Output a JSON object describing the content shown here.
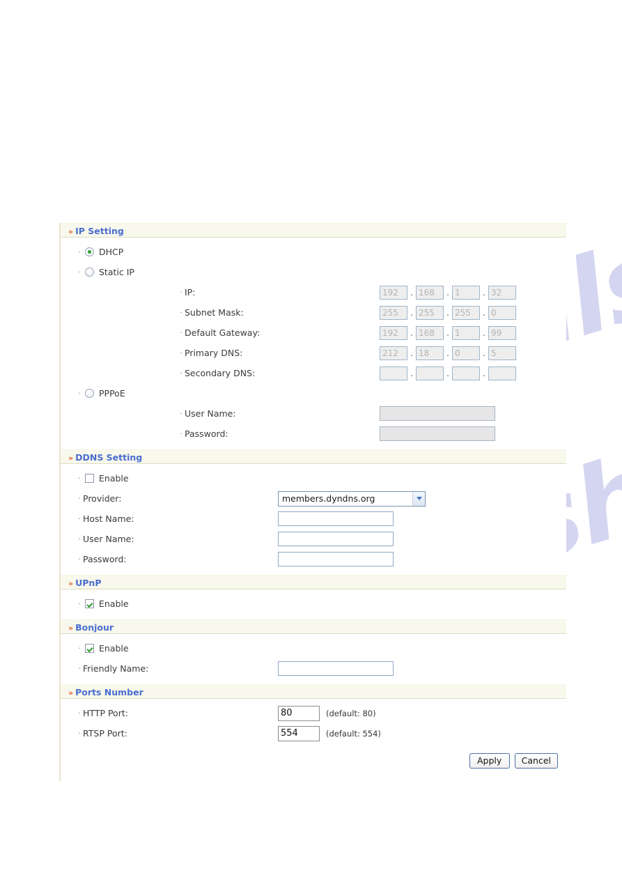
{
  "watermark": {
    "line1": "manualshive.com",
    "line2": "manualshive.com"
  },
  "sections": [
    {
      "id": "ip-setting",
      "title": "IP Setting",
      "marker": "»",
      "modes": [
        {
          "label": "DHCP",
          "selected": true
        },
        {
          "label": "Static IP",
          "selected": false
        },
        {
          "label": "PPPoE",
          "selected": false
        }
      ],
      "ip_rows": [
        {
          "label": "IP:",
          "octets": [
            "192",
            "168",
            "1",
            "32"
          ]
        },
        {
          "label": "Subnet Mask:",
          "octets": [
            "255",
            "255",
            "255",
            "0"
          ]
        },
        {
          "label": "Default Gateway:",
          "octets": [
            "192",
            "168",
            "1",
            "99"
          ]
        },
        {
          "label": "Primary DNS:",
          "octets": [
            "212",
            "18",
            "0",
            "5"
          ]
        },
        {
          "label": "Secondary DNS:",
          "octets": [
            "",
            "",
            "",
            ""
          ]
        }
      ],
      "pppoe_fields": [
        {
          "label": "User Name:",
          "value": ""
        },
        {
          "label": "Password:",
          "value": ""
        }
      ]
    },
    {
      "id": "ddns-setting",
      "title": "DDNS Setting",
      "marker": "»",
      "enable": {
        "label": "Enable",
        "checked": false
      },
      "provider": {
        "label": "Provider:",
        "selected": "members.dyndns.org",
        "options": [
          "members.dyndns.org"
        ]
      },
      "fields": [
        {
          "label": "Host Name:",
          "value": ""
        },
        {
          "label": "User Name:",
          "value": ""
        },
        {
          "label": "Password:",
          "value": ""
        }
      ]
    },
    {
      "id": "upnp",
      "title": "UPnP",
      "marker": "»",
      "enable": {
        "label": "Enable",
        "checked": true
      }
    },
    {
      "id": "bonjour",
      "title": "Bonjour",
      "marker": "»",
      "enable": {
        "label": "Enable",
        "checked": true
      },
      "friendly_name": {
        "label": "Friendly Name:",
        "value": ""
      }
    },
    {
      "id": "ports-number",
      "title": "Ports Number",
      "marker": "»",
      "ports": [
        {
          "label": "HTTP Port:",
          "value": "80",
          "hint": "(default: 80)"
        },
        {
          "label": "RTSP Port:",
          "value": "554",
          "hint": "(default: 554)"
        }
      ]
    }
  ],
  "buttons": {
    "apply": "Apply",
    "cancel": "Cancel"
  },
  "separator": ".",
  "bullet": "·",
  "colors": {
    "header_text": "#4a6ed0",
    "header_bg": "#f8f8ec",
    "marker": "#e0622a",
    "check": "#2d9b2d",
    "radio_dot": "#2fa02f"
  }
}
